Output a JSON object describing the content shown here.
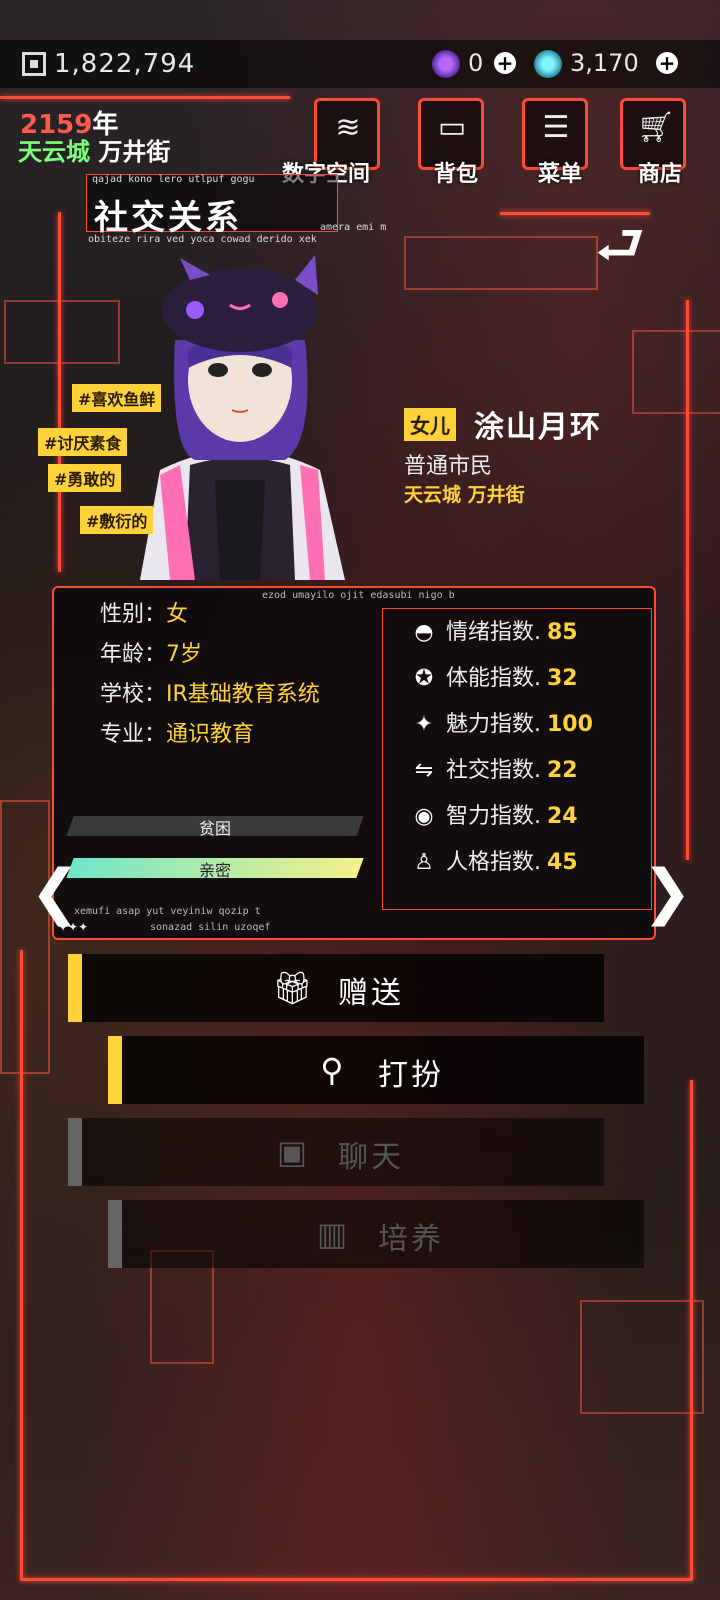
{
  "header": {
    "coins": "1,822,794",
    "res_a": "0",
    "res_b": "3,170",
    "year": "2159",
    "year_suffix": "年",
    "city": "天云城",
    "street": "万井街"
  },
  "nav": {
    "digital": "数字空间",
    "bag": "背包",
    "menu": "菜单",
    "shop": "商店"
  },
  "title": {
    "small": "qajad kono lero utlpuf gogu",
    "main": "社交关系",
    "sub": "obiteze rira ved yoca cowad derido xek",
    "sub2": "amera emi m"
  },
  "tags": [
    "#喜欢鱼鲜",
    "#讨厌素食",
    "#勇敢的",
    "#敷衍的"
  ],
  "character": {
    "relation": "女儿",
    "name": "涂山月环",
    "occupation": "普通市民",
    "location": "天云城 万井街"
  },
  "panel": {
    "caption": "ezod umayilo ojit edasubi nigo b",
    "gender_label": "性别：",
    "gender": "女",
    "age_label": "年龄：",
    "age": "7岁",
    "school_label": "学校：",
    "school": "IR基础教育系统",
    "major_label": "专业：",
    "major": "通识教育",
    "bar1": "贫困",
    "bar2": "亲密",
    "footer1": "xemufi asap yut veyiniw qozip t",
    "footer2": "sonazad silin uzoqef",
    "dots": "✦✦✦"
  },
  "stats": [
    {
      "icon": "emotion-icon",
      "label": "情绪指数.",
      "value": "85"
    },
    {
      "icon": "stamina-icon",
      "label": "体能指数.",
      "value": "32"
    },
    {
      "icon": "charm-icon",
      "label": "魅力指数.",
      "value": "100"
    },
    {
      "icon": "social-icon",
      "label": "社交指数.",
      "value": "22"
    },
    {
      "icon": "intellect-icon",
      "label": "智力指数.",
      "value": "24"
    },
    {
      "icon": "personality-icon",
      "label": "人格指数.",
      "value": "45"
    }
  ],
  "actions": {
    "gift": "赠送",
    "dress": "打扮",
    "chat": "聊天",
    "train": "培养"
  },
  "colors": {
    "accent": "#ff4a35",
    "highlight": "#ffd23a",
    "city": "#7dff7a"
  }
}
